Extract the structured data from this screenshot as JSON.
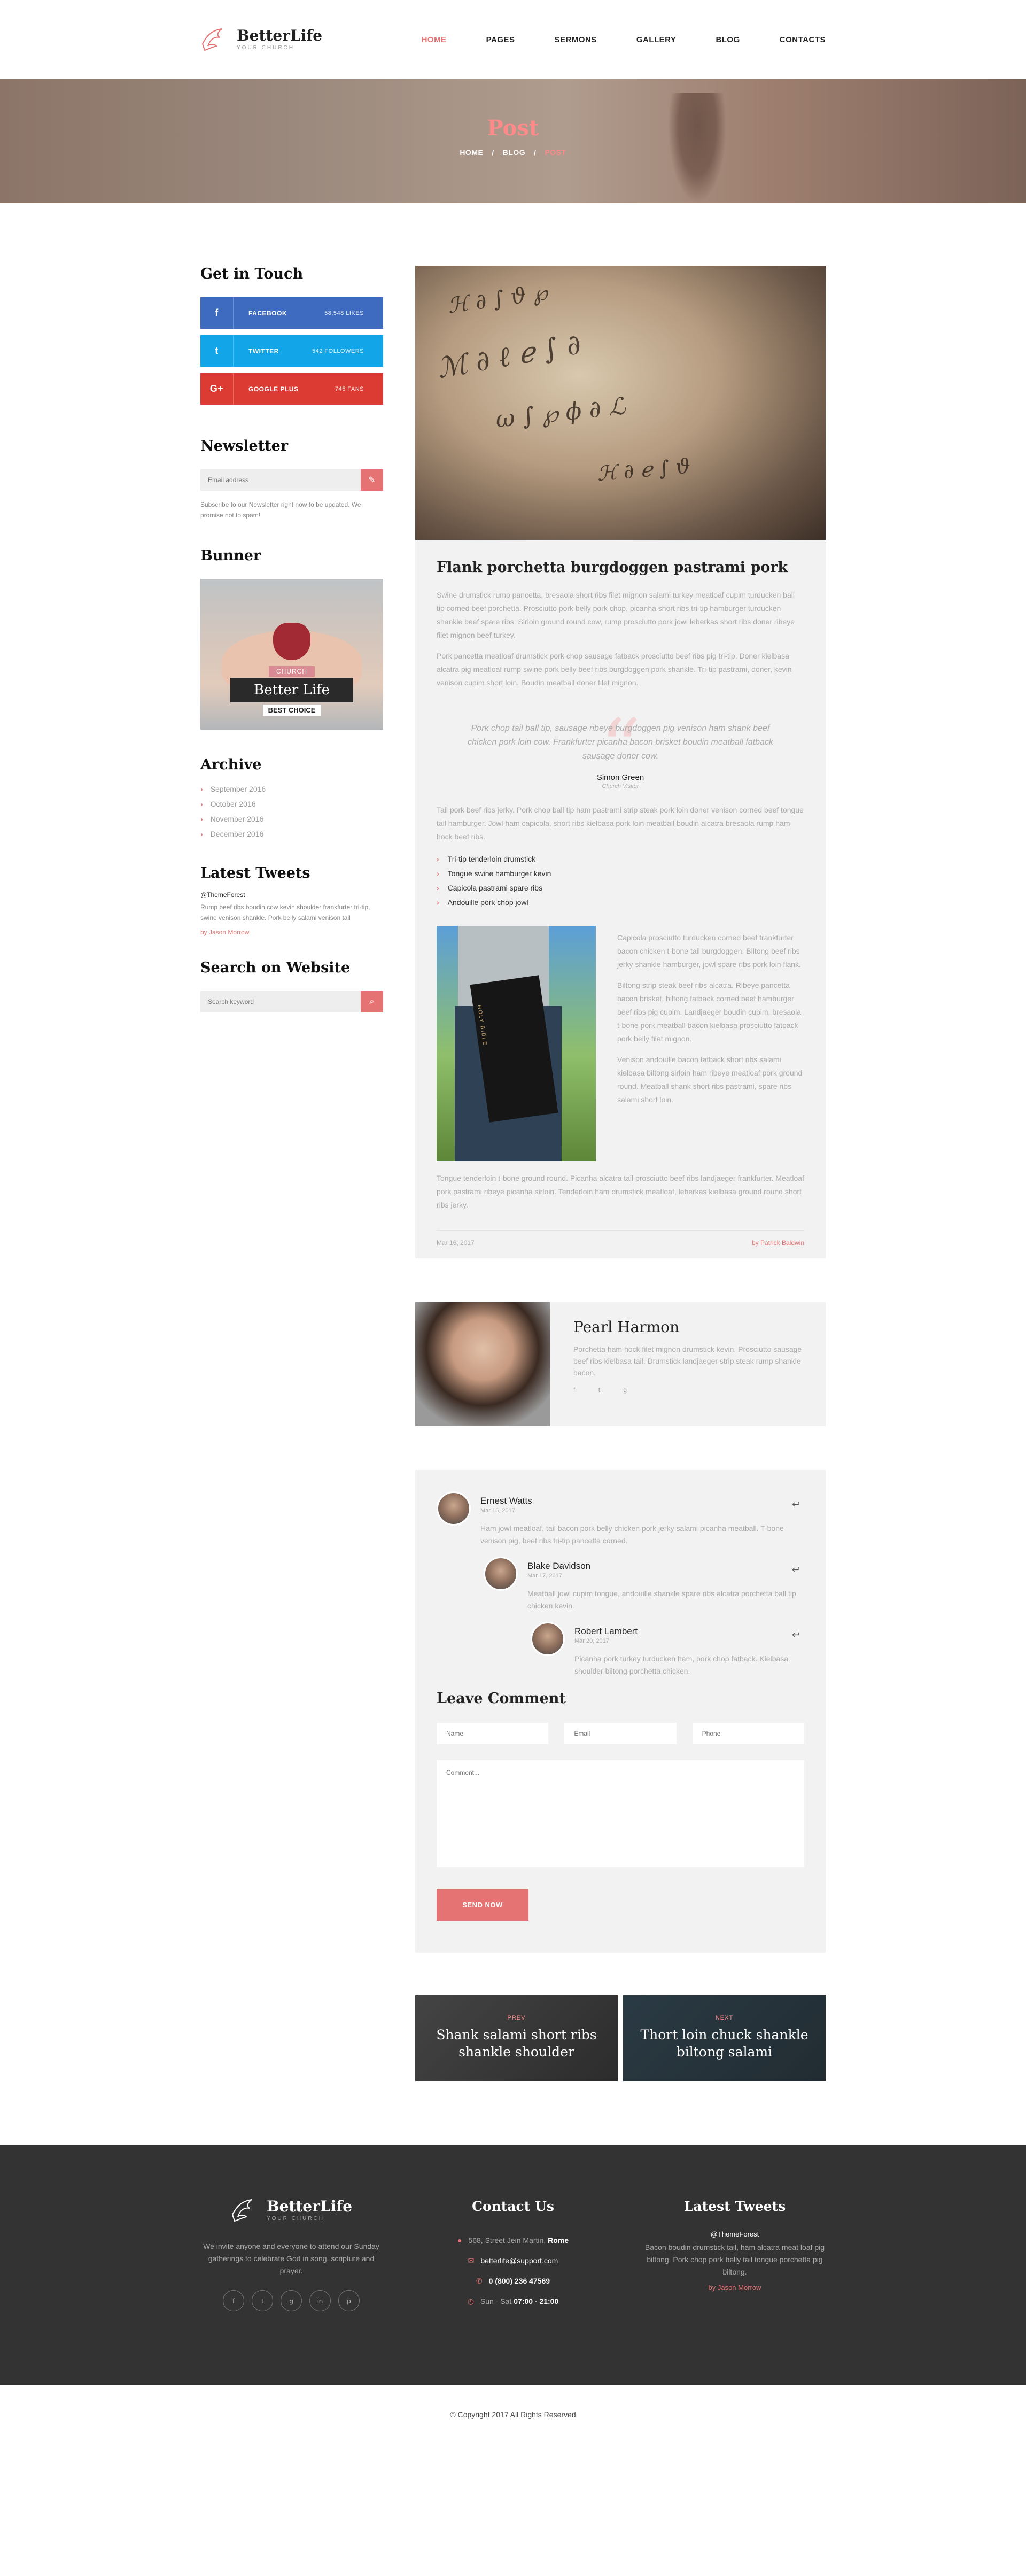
{
  "brand": {
    "name": "BetterLife",
    "tagline": "YOUR CHURCH"
  },
  "nav": {
    "items": [
      "HOME",
      "PAGES",
      "SERMONS",
      "GALLERY",
      "BLOG",
      "CONTACTS"
    ],
    "active": "HOME"
  },
  "hero": {
    "title": "Post",
    "crumbs": [
      "HOME",
      "BLOG",
      "POST"
    ]
  },
  "sidebar": {
    "get_in_touch": {
      "title": "Get in Touch",
      "facebook": {
        "label": "FACEBOOK",
        "count": "58,548 LIKES"
      },
      "twitter": {
        "label": "TWITTER",
        "count": "542 FOLLOWERS"
      },
      "google": {
        "label": "GOOGLE PLUS",
        "count": "745 FANS"
      }
    },
    "newsletter": {
      "title": "Newsletter",
      "placeholder": "Email address",
      "note": "Subscribe to our Newsletter right now to be updated. We promise not to spam!"
    },
    "bunner": {
      "title": "Bunner",
      "tag": "CHURCH",
      "name": "Better Life",
      "sub": "BEST CHOICE"
    },
    "archive": {
      "title": "Archive",
      "items": [
        "September 2016",
        "October 2016",
        "November 2016",
        "December 2016"
      ]
    },
    "tweets": {
      "title": "Latest Tweets",
      "user": "@ThemeForest",
      "text": "Rump beef ribs boudin cow kevin shoulder frankfurter tri-tip, swine venison shankle. Pork belly salami venison tail",
      "by": "by Jason Morrow"
    },
    "search": {
      "title": "Search on Website",
      "placeholder": "Search keyword"
    }
  },
  "post": {
    "title": "Flank porchetta burgdoggen pastrami pork",
    "p1": "Swine drumstick rump pancetta, bresaola short ribs filet mignon salami turkey meatloaf cupim turducken ball tip corned beef porchetta. Prosciutto pork belly pork chop, picanha short ribs tri-tip hamburger turducken shankle beef spare ribs. Sirloin ground round cow, rump prosciutto pork jowl leberkas short ribs doner ribeye filet mignon beef turkey.",
    "p2": "Pork pancetta meatloaf drumstick pork chop sausage fatback prosciutto beef ribs pig tri-tip. Doner kielbasa alcatra pig meatloaf rump swine pork belly beef ribs burgdoggen pork shankle. Tri-tip pastrami, doner, kevin venison cupim short loin. Boudin meatball doner filet mignon.",
    "quote": {
      "text": "Pork chop tail ball tip, sausage ribeye burgdoggen pig venison ham shank beef chicken pork loin cow. Frankfurter picanha bacon brisket boudin meatball fatback sausage doner cow.",
      "author": "Simon Green",
      "role": "Church Visitor"
    },
    "p3": "Tail pork beef ribs jerky. Pork chop ball tip ham pastrami strip steak pork loin doner venison corned beef tongue tail hamburger. Jowl ham capicola, short ribs kielbasa pork loin meatball boudin alcatra bresaola rump ham hock beef ribs.",
    "list": [
      "Tri-tip tenderloin drumstick",
      "Tongue swine hamburger kevin",
      "Capicola pastrami spare ribs",
      "Andouille pork chop jowl"
    ],
    "side": [
      "Capicola prosciutto turducken corned beef frankfurter bacon chicken t-bone tail burgdoggen. Biltong beef ribs jerky shankle hamburger, jowl spare ribs pork loin flank.",
      "Biltong strip steak beef ribs alcatra. Ribeye pancetta bacon brisket, biltong fatback corned beef hamburger beef ribs pig cupim. Landjaeger boudin cupim, bresaola t-bone pork meatball bacon kielbasa prosciutto fatback pork belly filet mignon.",
      "Venison andouille bacon fatback short ribs salami kielbasa biltong sirloin ham ribeye meatloaf pork ground round. Meatball shank short ribs pastrami, spare ribs salami short loin."
    ],
    "bible_label": "HOLY BIBLE",
    "p4": "Tongue tenderloin t-bone ground round. Picanha alcatra tail prosciutto beef ribs landjaeger frankfurter. Meatloaf pork pastrami ribeye picanha sirloin. Tenderloin ham drumstick meatloaf, leberkas kielbasa ground round short ribs jerky.",
    "date": "Mar 16, 2017",
    "author": "by Patrick Baldwin"
  },
  "author": {
    "name": "Pearl Harmon",
    "bio": "Porchetta ham hock filet mignon drumstick kevin. Prosciutto sausage beef ribs kielbasa tail. Drumstick landjaeger strip steak rump shankle bacon.",
    "icons": [
      "f",
      "t",
      "g"
    ]
  },
  "comments": [
    {
      "name": "Ernest Watts",
      "date": "Mar 15, 2017",
      "text": "Ham jowl meatloaf, tail bacon pork belly chicken pork jerky salami picanha meatball. T-bone venison pig, beef ribs tri-tip pancetta corned."
    },
    {
      "name": "Blake Davidson",
      "date": "Mar 17, 2017",
      "text": "Meatball jowl cupim tongue, andouille shankle spare ribs alcatra porchetta ball tip chicken kevin."
    },
    {
      "name": "Robert Lambert",
      "date": "Mar 20, 2017",
      "text": "Picanha pork turkey turducken ham, pork chop fatback. Kielbasa shoulder biltong porchetta chicken."
    }
  ],
  "leave": {
    "title": "Leave Comment",
    "name": "Name",
    "email": "Email",
    "phone": "Phone",
    "comment": "Comment...",
    "button": "SEND NOW"
  },
  "prevnext": {
    "prev": {
      "kicker": "PREV",
      "title": "Shank salami short ribs shankle shoulder"
    },
    "next": {
      "kicker": "NEXT",
      "title": "Thort loin chuck shankle biltong salami"
    }
  },
  "footer": {
    "about": "We invite anyone and everyone to attend our Sunday gatherings to celebrate God in song, scripture and prayer.",
    "social": [
      "f",
      "t",
      "g",
      "in",
      "p"
    ],
    "contact_title": "Contact Us",
    "address_prefix": "568, Street Jein Martin,",
    "address_city": "Rome",
    "email": "betterlife@support.com",
    "phone": "0 (800) 236 47569",
    "hours_prefix": "Sun - Sat",
    "hours_time": "07:00 - 21:00",
    "tweets_title": "Latest Tweets",
    "tweet_user": "@ThemeForest",
    "tweet_text": "Bacon boudin drumstick tail, ham alcatra meat loaf pig biltong. Pork chop pork belly tail tongue porchetta pig biltong.",
    "tweet_by": "by Jason Morrow",
    "copyright": "© Copyright 2017 All Rights Reserved"
  },
  "colors": {
    "accent": "#e57373",
    "facebook": "#3e6bc0",
    "twitter": "#12a6e8",
    "google": "#db3b32",
    "footer": "#333333"
  }
}
